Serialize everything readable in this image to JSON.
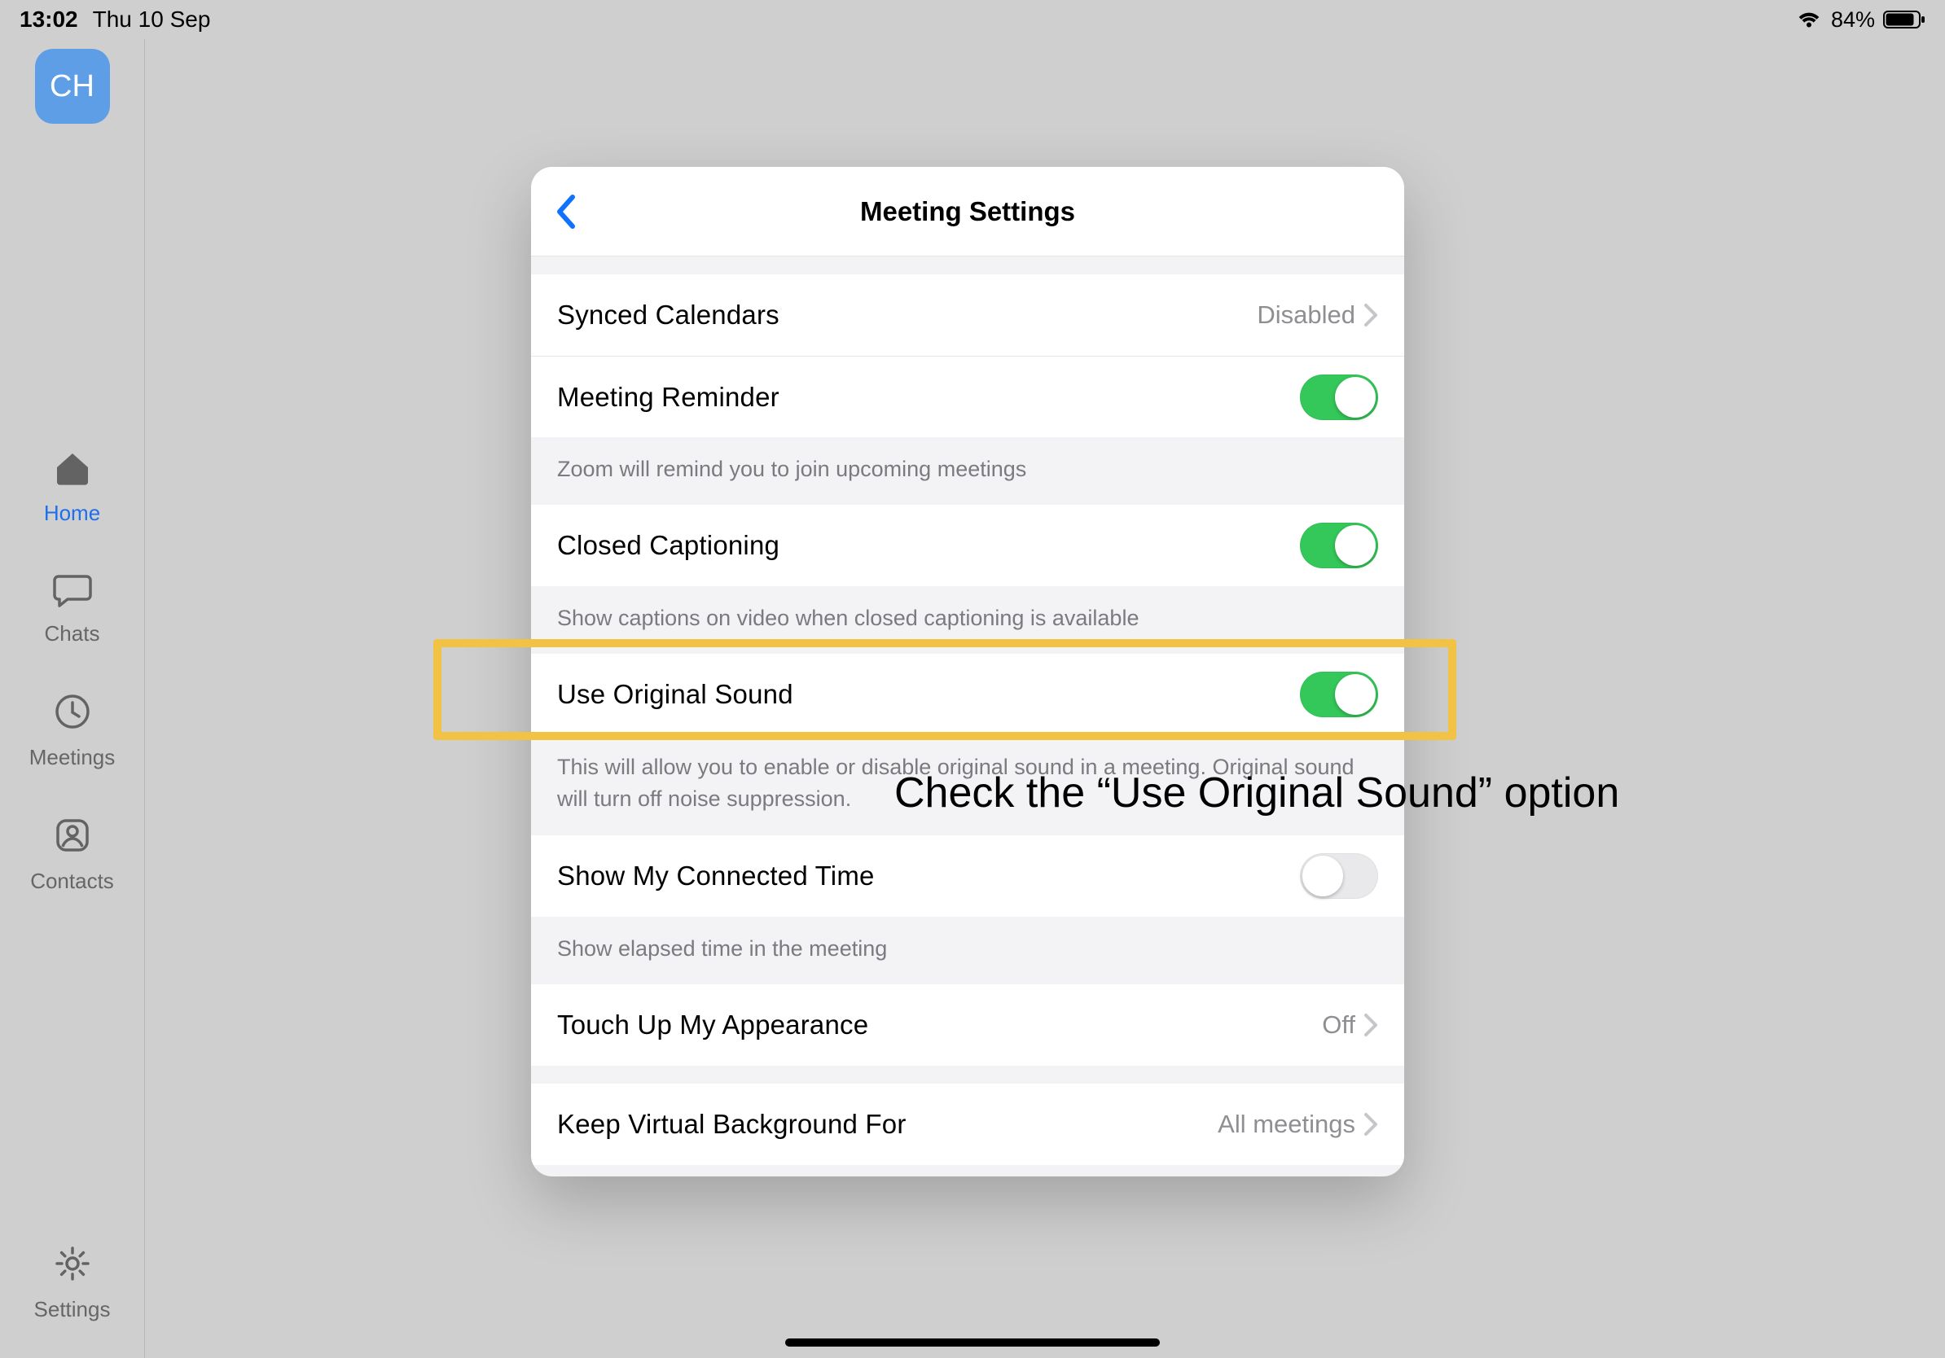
{
  "status": {
    "time": "13:02",
    "date": "Thu 10 Sep",
    "battery_pct": "84%"
  },
  "sidebar": {
    "avatar_initials": "CH",
    "items": [
      {
        "label": "Home"
      },
      {
        "label": "Chats"
      },
      {
        "label": "Meetings"
      },
      {
        "label": "Contacts"
      },
      {
        "label": "Settings"
      }
    ]
  },
  "modal": {
    "title": "Meeting Settings",
    "rows": {
      "synced_calendars": {
        "label": "Synced Calendars",
        "value": "Disabled"
      },
      "meeting_reminder": {
        "label": "Meeting Reminder",
        "desc": "Zoom will remind you to join upcoming meetings",
        "on": true
      },
      "closed_captioning": {
        "label": "Closed Captioning",
        "desc": "Show captions on video when closed captioning is available",
        "on": true
      },
      "use_original_sound": {
        "label": "Use Original Sound",
        "desc": "This will allow you to enable or disable original sound in a meeting. Original sound will turn off noise suppression.",
        "on": true
      },
      "show_connected_time": {
        "label": "Show My Connected Time",
        "desc": "Show elapsed time in the meeting",
        "on": false
      },
      "touch_up": {
        "label": "Touch Up My Appearance",
        "value": "Off"
      },
      "keep_vbg": {
        "label": "Keep Virtual Background For",
        "value": "All meetings"
      }
    }
  },
  "annotation": {
    "text": "Check the “Use Original Sound” option"
  }
}
